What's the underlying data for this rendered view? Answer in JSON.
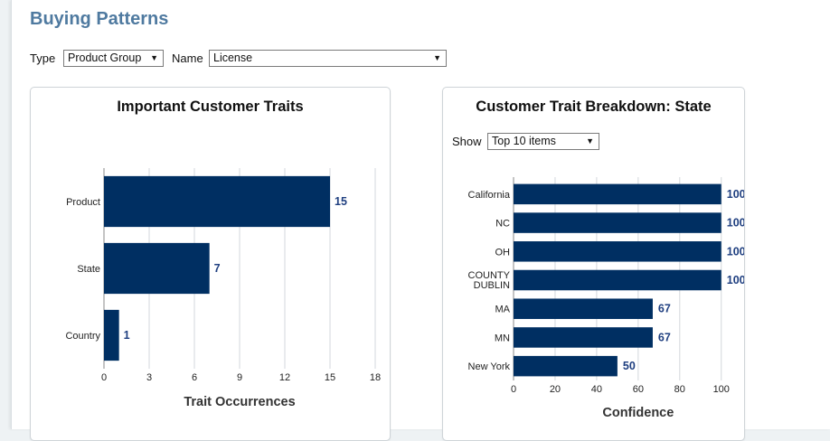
{
  "page": {
    "title": "Buying Patterns"
  },
  "filters": {
    "type_label": "Type",
    "type_value": "Product Group",
    "name_label": "Name",
    "name_value": "License"
  },
  "traits_panel": {
    "title": "Important Customer Traits"
  },
  "breakdown_panel": {
    "title": "Customer Trait Breakdown: State",
    "show_label": "Show",
    "show_value": "Top 10 items"
  },
  "colors": {
    "bar": "#002f62",
    "value_label": "#1f3f80",
    "title": "#4f7aa0",
    "grid": "#d3d7dc"
  },
  "chart_data": [
    {
      "type": "bar",
      "orientation": "horizontal",
      "title": "Important Customer Traits",
      "categories": [
        "Product",
        "State",
        "Country"
      ],
      "values": [
        15,
        7,
        1
      ],
      "xlabel": "Trait Occurrences",
      "ylabel": "",
      "xlim": [
        0,
        18
      ],
      "ticks": [
        0,
        3,
        6,
        9,
        12,
        15,
        18
      ],
      "grid": true
    },
    {
      "type": "bar",
      "orientation": "horizontal",
      "title": "Customer Trait Breakdown: State",
      "categories": [
        "California",
        "NC",
        "OH",
        "COUNTY DUBLIN",
        "MA",
        "MN",
        "New York"
      ],
      "values": [
        100,
        100,
        100,
        100,
        67,
        67,
        50
      ],
      "xlabel": "Confidence",
      "ylabel": "",
      "xlim": [
        0,
        120
      ],
      "ticks": [
        0,
        20,
        40,
        60,
        80,
        100,
        120
      ],
      "grid": true
    }
  ]
}
